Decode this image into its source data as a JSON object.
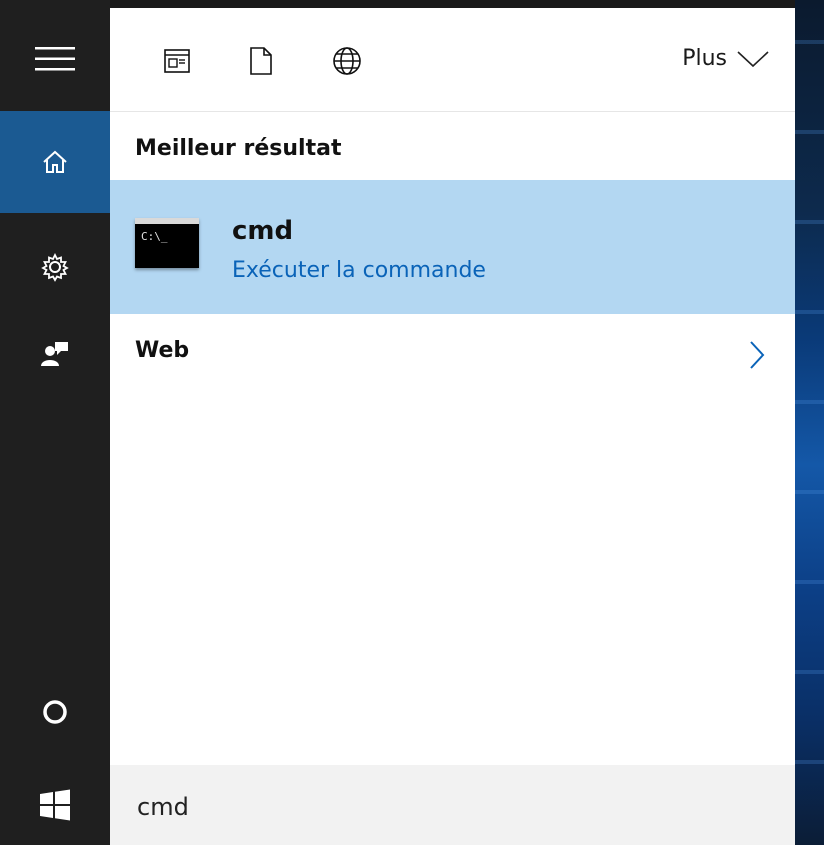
{
  "toolbar": {
    "icons": [
      "app-window-icon",
      "document-icon",
      "globe-icon"
    ],
    "plus_label": "Plus"
  },
  "rail": {
    "items": [
      "hamburger-icon",
      "home-icon",
      "settings-gear-icon",
      "user-feedback-icon",
      "cortana-circle-icon",
      "windows-logo-icon"
    ]
  },
  "results": {
    "best_header": "Meilleur résultat",
    "best": {
      "title": "cmd",
      "subtitle": "Exécuter la commande",
      "icon_prompt": "C:\\_"
    },
    "web_label": "Web"
  },
  "search": {
    "value": "cmd"
  },
  "colors": {
    "rail_bg": "#1f1f1f",
    "rail_active": "#1b5a92",
    "highlight": "#b3d7f2",
    "link": "#0a63b8",
    "searchbar_bg": "#f2f2f2"
  }
}
